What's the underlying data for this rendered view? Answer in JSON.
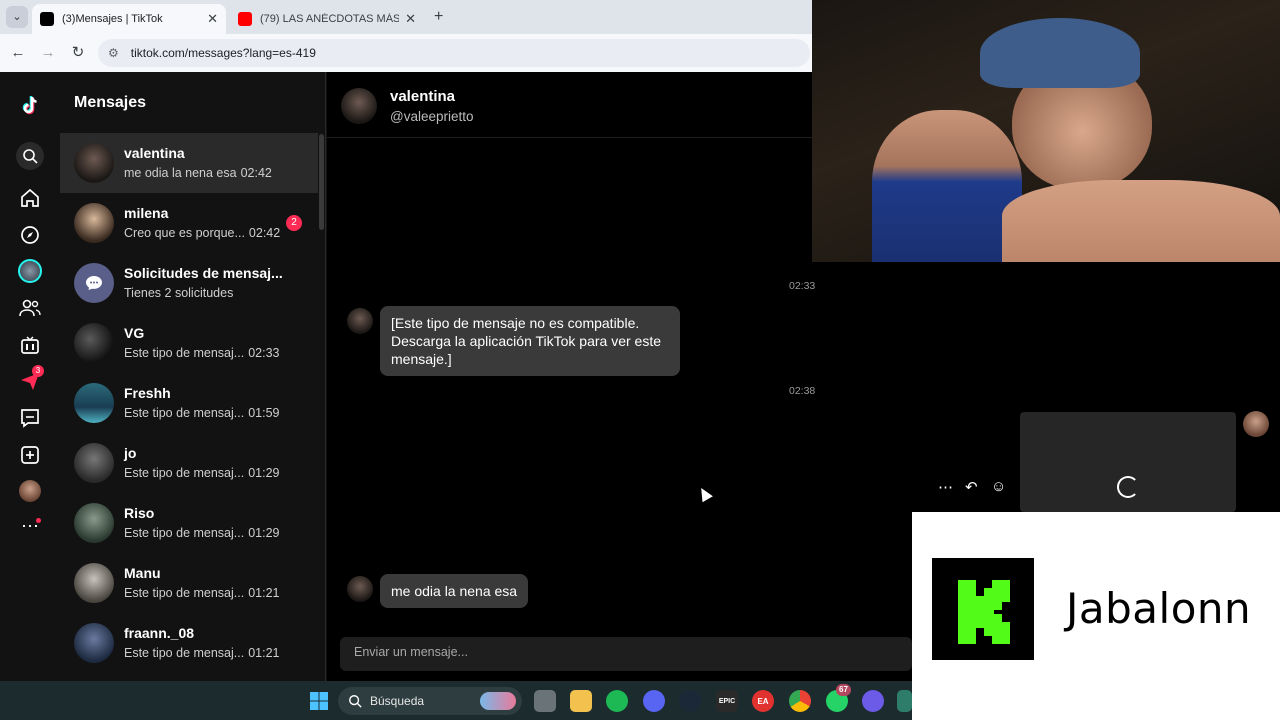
{
  "browser": {
    "tabs": [
      {
        "title": "(3)Mensajes | TikTok",
        "active": true
      },
      {
        "title": "(79) LAS ANÉCDOTAS MÁS PAR",
        "active": false
      }
    ],
    "url": "tiktok.com/messages?lang=es-419"
  },
  "sidebar": {
    "heading": "Mensajes",
    "rail_icons": [
      "tiktok-logo-icon",
      "search-icon",
      "home-icon",
      "explore-icon",
      "live-avatar-icon",
      "following-icon",
      "live-tv-icon",
      "send-icon",
      "messages-icon",
      "upload-icon",
      "profile-icon",
      "more-icon"
    ],
    "rail_badges": {
      "send": "3"
    }
  },
  "conversations": [
    {
      "name": "valentina",
      "preview": "me odia la nena esa",
      "time": "02:42",
      "unread": "",
      "selected": true
    },
    {
      "name": "milena",
      "preview": "Creo que es porque...",
      "time": "02:42",
      "unread": "2",
      "selected": false
    },
    {
      "name": "Solicitudes de mensaj...",
      "preview": "Tienes 2 solicitudes",
      "time": "",
      "unread": "",
      "selected": false
    },
    {
      "name": "VG",
      "preview": "Este tipo de mensaj...",
      "time": "02:33",
      "unread": "",
      "selected": false
    },
    {
      "name": "Freshh",
      "preview": "Este tipo de mensaj...",
      "time": "01:59",
      "unread": "",
      "selected": false
    },
    {
      "name": "jo",
      "preview": "Este tipo de mensaj...",
      "time": "01:29",
      "unread": "",
      "selected": false
    },
    {
      "name": "Riso",
      "preview": "Este tipo de mensaj...",
      "time": "01:29",
      "unread": "",
      "selected": false
    },
    {
      "name": "Manu",
      "preview": "Este tipo de mensaj...",
      "time": "01:21",
      "unread": "",
      "selected": false
    },
    {
      "name": "fraann._08",
      "preview": "Este tipo de mensaj...",
      "time": "01:21",
      "unread": "",
      "selected": false
    }
  ],
  "chat": {
    "name": "valentina",
    "handle": "@valeeprietto",
    "timestamps": [
      "02:33",
      "02:38"
    ],
    "messages": [
      {
        "text": "[Este tipo de mensaje no es compatible. Descarga la aplicación TikTok para ver este mensaje.]"
      },
      {
        "text": "me odia la nena esa"
      }
    ],
    "compose_placeholder": "Enviar un mensaje..."
  },
  "stream": {
    "channel_name": "Jabalonn",
    "brand_color": "#53fc18"
  },
  "taskbar": {
    "search_label": "Búsqueda",
    "whatsapp_badge": "67"
  }
}
